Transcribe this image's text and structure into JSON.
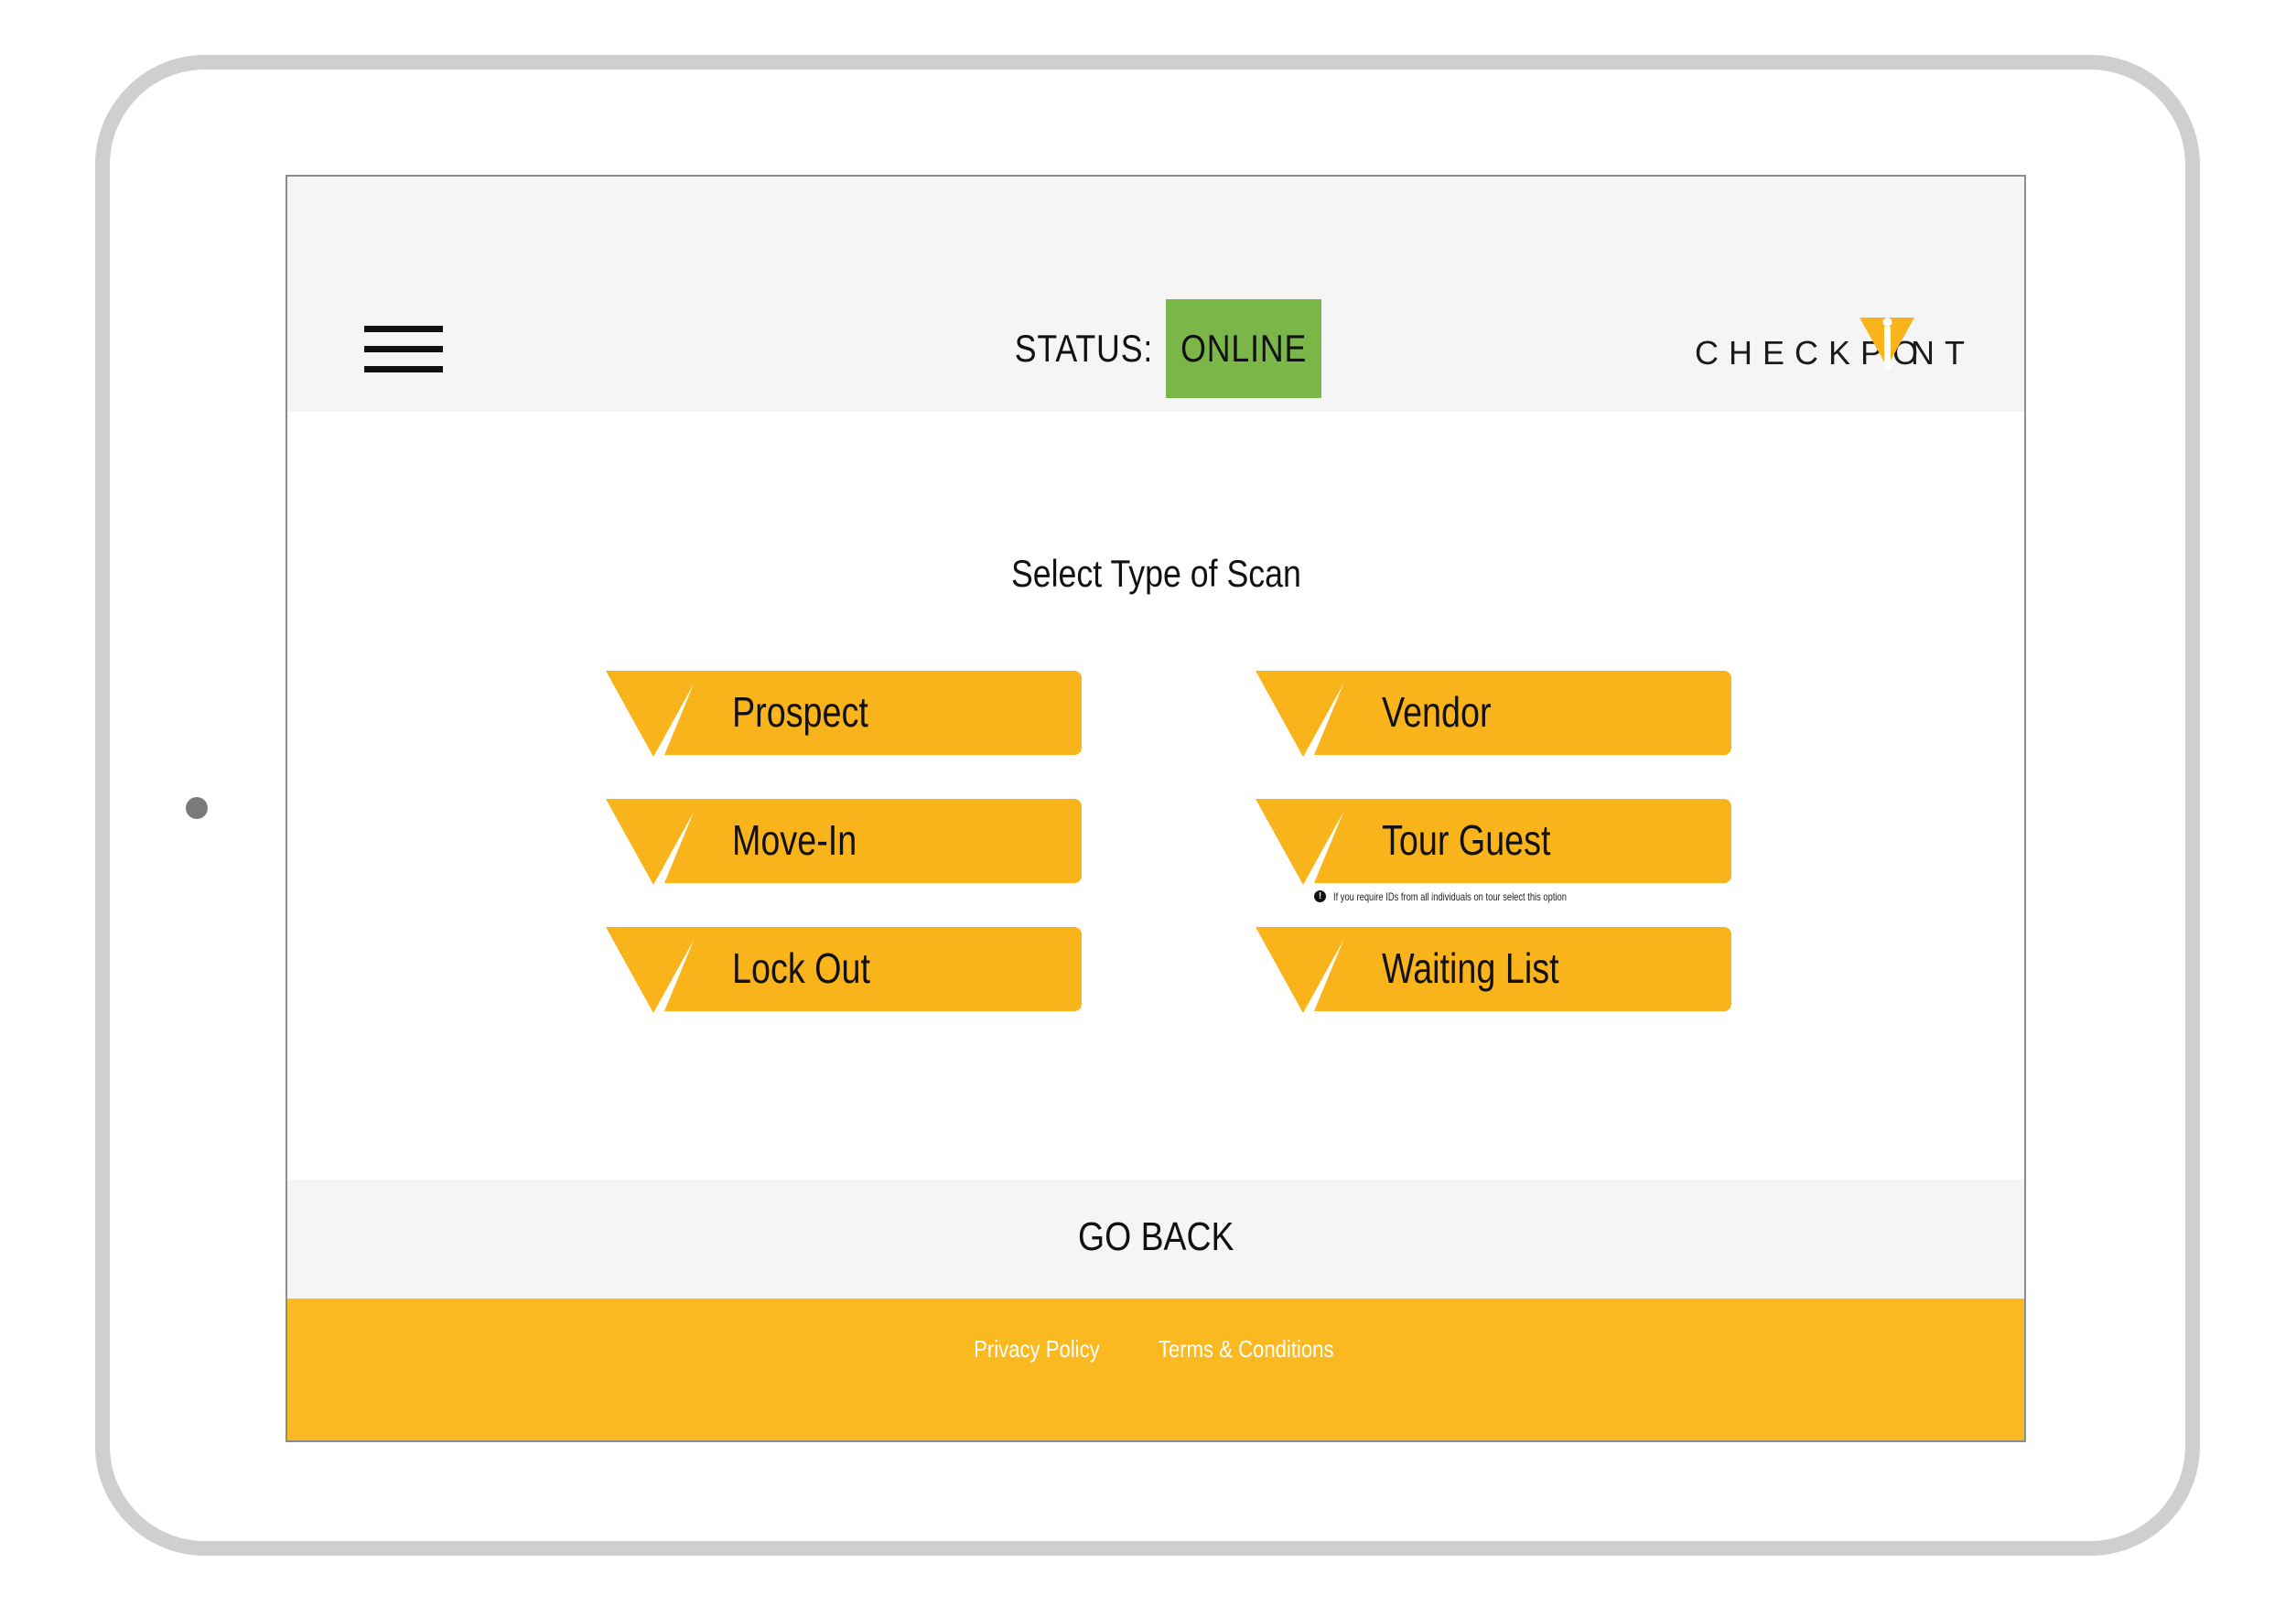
{
  "header": {
    "status_label": "STATUS:",
    "status_value": "ONLINE",
    "logo_text_left": "CHECKPO",
    "logo_text_right": "NT",
    "menu_icon": "hamburger-menu-icon",
    "logo_icon": "checkpoint-i-triangle-icon"
  },
  "main": {
    "title": "Select Type of Scan",
    "buttons_left": [
      {
        "label": "Prospect"
      },
      {
        "label": "Move-In"
      },
      {
        "label": "Lock Out"
      }
    ],
    "buttons_right": [
      {
        "label": "Vendor"
      },
      {
        "label": "Tour Guest"
      },
      {
        "label": "Waiting List"
      }
    ],
    "tour_guest_hint": "If you require IDs from all individuals on tour select this option",
    "hint_icon": "info-icon"
  },
  "nav": {
    "go_back": "GO BACK"
  },
  "footer": {
    "privacy": "Privacy Policy",
    "terms": "Terms & Conditions"
  },
  "colors": {
    "accent": "#f9b31b",
    "footer": "#fbb921",
    "status_online": "#7ab648",
    "header_bg": "#f5f5f5"
  }
}
